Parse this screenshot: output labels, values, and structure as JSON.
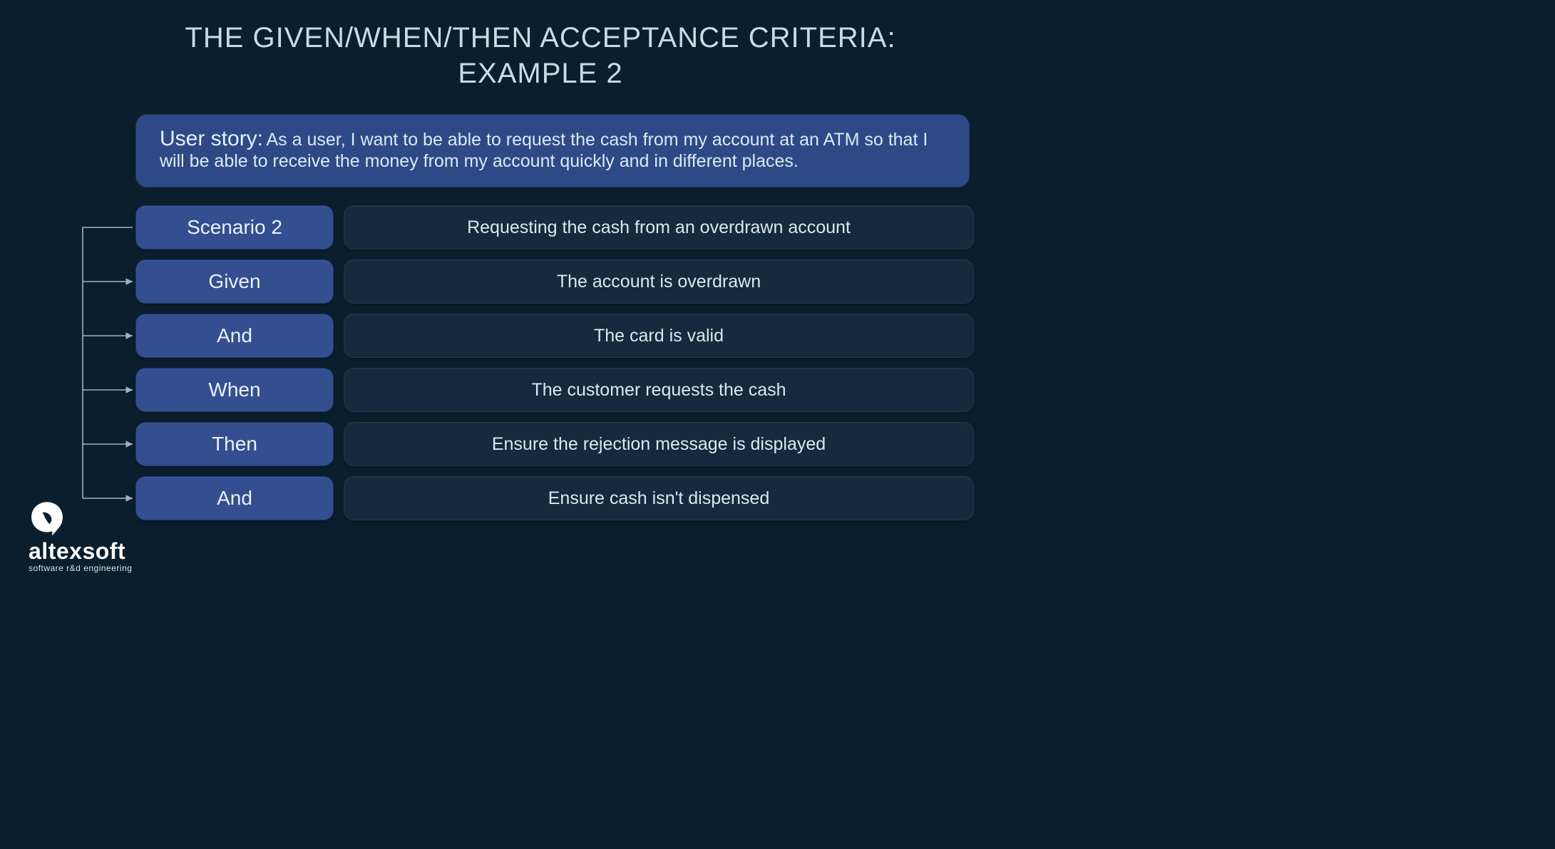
{
  "title_line1": "THE GIVEN/WHEN/THEN ACCEPTANCE CRITERIA:",
  "title_line2": "EXAMPLE 2",
  "user_story": {
    "label": "User story:",
    "text": "As a user, I want to be able to request the cash from my account at an ATM so that I will be able to receive the money from my account quickly and in different places."
  },
  "rows": [
    {
      "keyword": "Scenario 2",
      "description": "Requesting the cash from an overdrawn account"
    },
    {
      "keyword": "Given",
      "description": "The account is overdrawn"
    },
    {
      "keyword": "And",
      "description": "The card is valid"
    },
    {
      "keyword": "When",
      "description": "The customer requests the cash"
    },
    {
      "keyword": "Then",
      "description": "Ensure the rejection message is displayed"
    },
    {
      "keyword": "And",
      "description": "Ensure cash isn't dispensed"
    }
  ],
  "branding": {
    "name": "altexsoft",
    "tagline": "software r&d engineering"
  },
  "colors": {
    "background": "#0b1e2d",
    "keyword_pill": "#344f8f",
    "user_story_bg": "#2d4a87",
    "desc_pill": "#152a3c",
    "text": "#d8e6ef"
  }
}
